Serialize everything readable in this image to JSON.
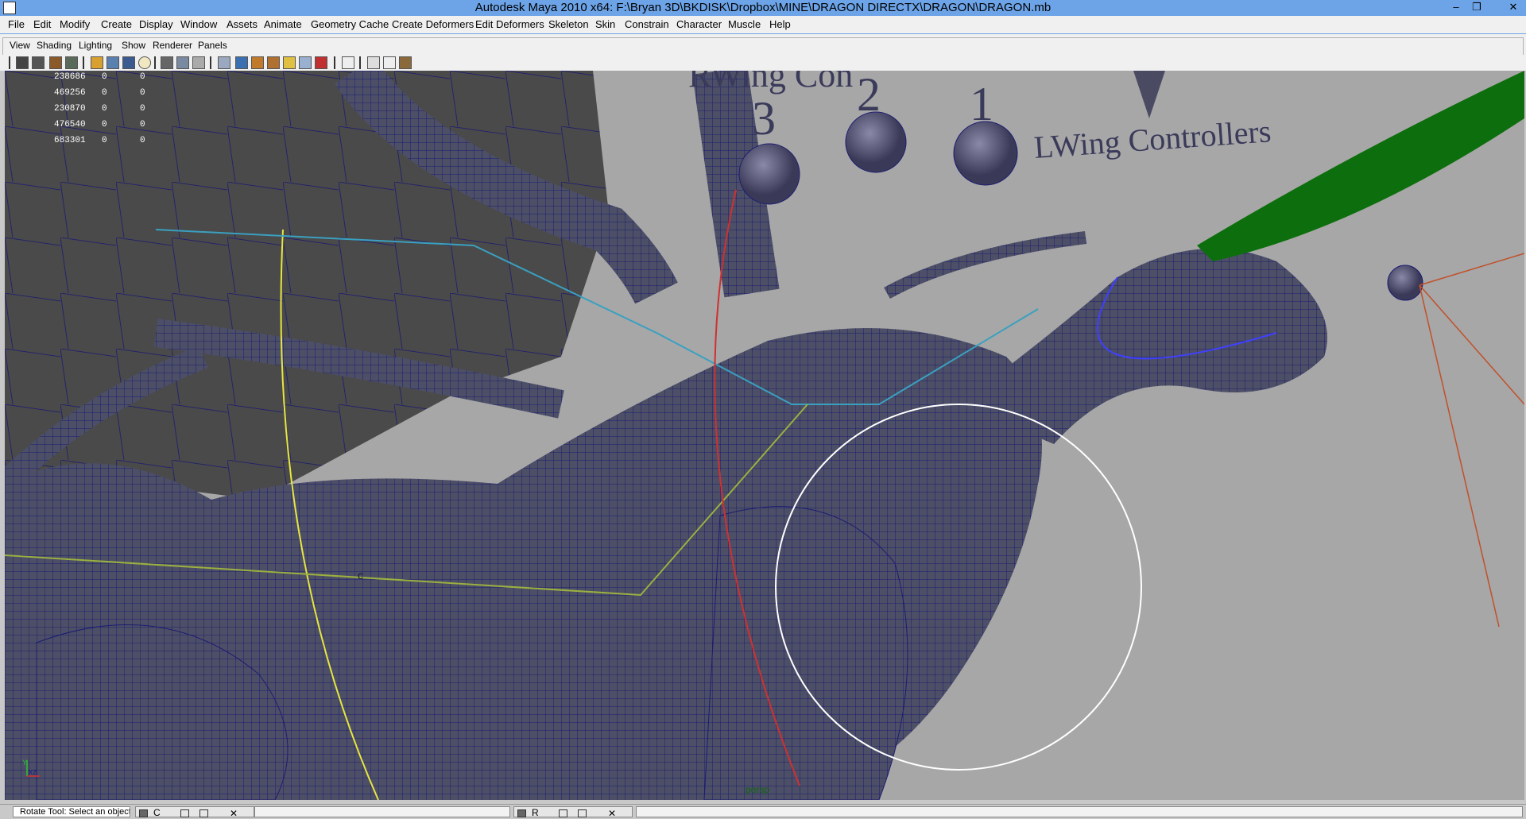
{
  "window": {
    "title": "Autodesk Maya 2010 x64: F:\\Bryan 3D\\BKDISK\\Dropbox\\MINE\\DRAGON DIRECTX\\DRAGON\\DRAGON.mb",
    "minimize": "–",
    "restore": "❐",
    "close": "✕"
  },
  "menubar": [
    "File",
    "Edit",
    "Modify",
    "Create",
    "Display",
    "Window",
    "Assets",
    "Animate",
    "Geometry Cache",
    "Create Deformers",
    "Edit Deformers",
    "Skeleton",
    "Skin",
    "Constrain",
    "Character",
    "Muscle",
    "Help"
  ],
  "panelmenu": [
    "View",
    "Shading",
    "Lighting",
    "Show",
    "Renderer",
    "Panels"
  ],
  "toolbar_icons": [
    "select-camera-icon",
    "lock-camera-icon",
    "bookmark-icon",
    "image-plane-icon",
    "2d-pan-icon",
    "grid-icon",
    "film-gate-icon",
    "resolution-gate-icon",
    "gate-mask-icon",
    "field-chart-icon",
    "safe-action-icon",
    "wireframe-icon",
    "smooth-shade-icon",
    "texture-icon",
    "light-icon",
    "shadow-icon",
    "xray-icon",
    "isolate-icon",
    "frame-all-icon",
    "frame-selected-icon",
    "hud-icon",
    "camera-attr-icon"
  ],
  "hud": {
    "rows": [
      {
        "label": "",
        "v1": "238686",
        "v2": "0",
        "v3": "0"
      },
      {
        "label": "",
        "v1": "469256",
        "v2": "0",
        "v3": "0"
      },
      {
        "label": "",
        "v1": "230870",
        "v2": "0",
        "v3": "0"
      },
      {
        "label": "",
        "v1": "476540",
        "v2": "0",
        "v3": "0"
      },
      {
        "label": "",
        "v1": "683301",
        "v2": "0",
        "v3": "0"
      }
    ]
  },
  "scene": {
    "labels": [
      "RWing Con",
      "3",
      "2",
      "1",
      "LWing Controllers",
      "c"
    ],
    "camera": "persp",
    "axis": {
      "y": "Y",
      "xz": "xz"
    }
  },
  "bottombar": {
    "help_text": "Rotate Tool: Select an object",
    "task1": "C",
    "task2": "R",
    "close": "✕"
  },
  "colors": {
    "titlebar": "#6da4e8",
    "viewport_bg": "#a7a7a7",
    "mesh": "#4a4a62",
    "wire": "#1a1a7a",
    "glow": "#0d6e0d"
  }
}
